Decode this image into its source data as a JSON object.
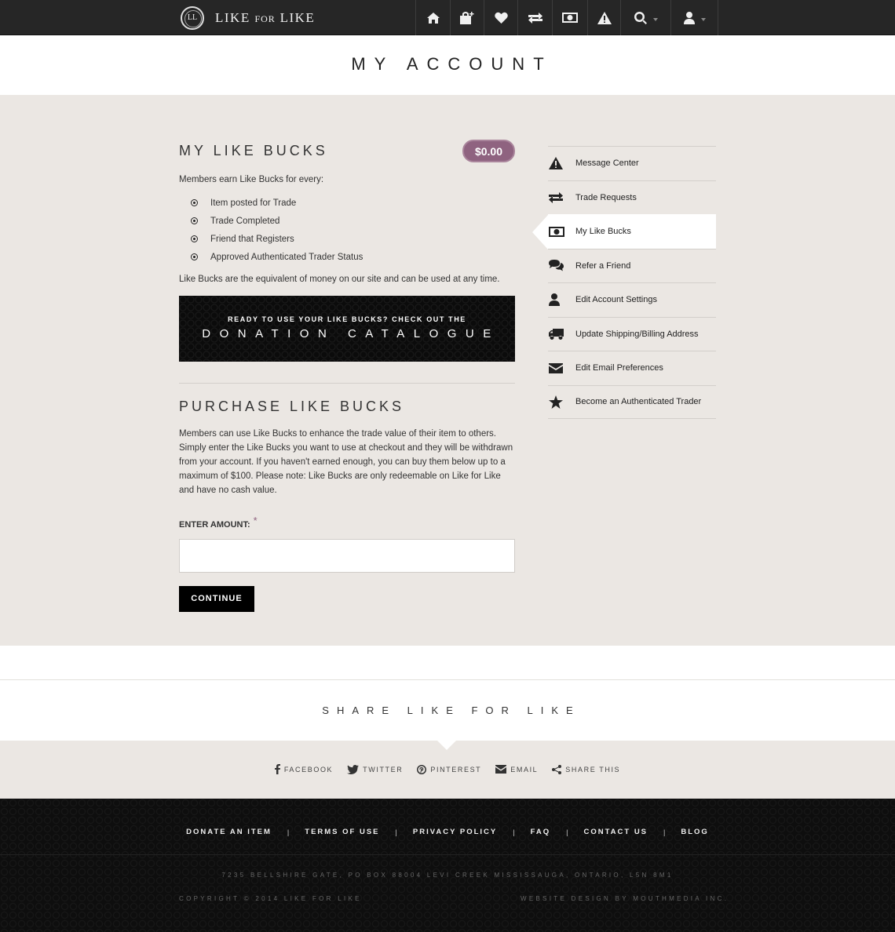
{
  "header": {
    "logo_mark": "LL",
    "logo_text_1": "LIKE",
    "logo_text_for": "FOR",
    "logo_text_2": "LIKE",
    "nav_icons": [
      "home-icon",
      "shopping-bag-plus-icon",
      "heart-icon",
      "exchange-icon",
      "money-icon",
      "warning-icon",
      "search-icon",
      "user-icon"
    ]
  },
  "page_title": "MY ACCOUNT",
  "like_bucks": {
    "heading": "MY LIKE BUCKS",
    "balance": "$0.00",
    "intro": "Members earn Like Bucks for every:",
    "items": [
      "Item posted for Trade",
      "Trade Completed",
      "Friend that Registers",
      "Approved Authenticated Trader Status"
    ],
    "note": "Like Bucks are the equivalent of money on our site and can be used at any time."
  },
  "promo": {
    "small": "READY TO USE YOUR LIKE BUCKS? CHECK OUT THE",
    "big": "DONATION CATALOGUE"
  },
  "purchase": {
    "heading": "PURCHASE LIKE BUCKS",
    "description": "Members can use Like Bucks to enhance the trade value of their item to others. Simply enter the Like Bucks you want to use at checkout and they will be withdrawn from your account. If you haven't earned enough, you can buy them below up to a maximum of $100. Please note: Like Bucks are only redeemable on Like for Like and have no cash value.",
    "amount_label": "ENTER AMOUNT:",
    "required_mark": "*",
    "amount_value": "",
    "continue_label": "CONTINUE"
  },
  "sidebar": {
    "items": [
      {
        "label": "Message Center",
        "icon": "warning-icon"
      },
      {
        "label": "Trade Requests",
        "icon": "exchange-icon"
      },
      {
        "label": "My Like Bucks",
        "icon": "money-icon",
        "active": true
      },
      {
        "label": "Refer a Friend",
        "icon": "comments-icon"
      },
      {
        "label": "Edit Account Settings",
        "icon": "user-icon"
      },
      {
        "label": "Update Shipping/Billing Address",
        "icon": "truck-icon"
      },
      {
        "label": "Edit Email Preferences",
        "icon": "envelope-icon"
      },
      {
        "label": "Become an Authenticated Trader",
        "icon": "star-icon"
      }
    ]
  },
  "share": {
    "title": "SHARE LIKE FOR LIKE",
    "links": [
      {
        "label": "FACEBOOK",
        "icon": "facebook-icon"
      },
      {
        "label": "TWITTER",
        "icon": "twitter-icon"
      },
      {
        "label": "PINTEREST",
        "icon": "pinterest-icon"
      },
      {
        "label": "EMAIL",
        "icon": "envelope-icon"
      },
      {
        "label": "SHARE THIS",
        "icon": "share-icon"
      }
    ]
  },
  "footer": {
    "links": [
      "DONATE AN ITEM",
      "TERMS OF USE",
      "PRIVACY POLICY",
      "FAQ",
      "CONTACT US",
      "BLOG"
    ],
    "separator": "|",
    "address": "7235 BELLSHIRE GATE, PO BOX 88004 LEVI CREEK MISSISSAUGA, ONTARIO, L5N 8M1",
    "copyright": "COPYRIGHT © 2014 LIKE FOR LIKE",
    "design_credit": "WEBSITE DESIGN BY MOUTHMEDIA INC."
  },
  "colors": {
    "accent": "#8f6380",
    "topbar": "#262626",
    "main_bg": "#ebe7e3"
  }
}
